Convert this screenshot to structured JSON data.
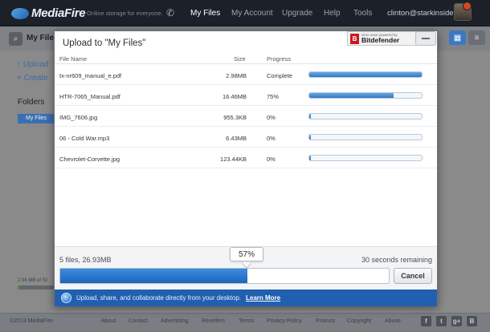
{
  "topbar": {
    "logo": "MediaFire",
    "tagline": "Online storage for everyone.",
    "nav": [
      "My Files",
      "My Account",
      "Upgrade",
      "Help",
      "Tools"
    ],
    "user_email": "clinton@starkinsider..."
  },
  "background": {
    "title": "My Files",
    "upload_link": "Upload",
    "create_link": "Create",
    "folders_heading": "Folders",
    "folder_item": "My Files",
    "storage_text": "2.98 MB of 50",
    "storage_fraction": 0.06,
    "copyright": "©2013 MediaFire",
    "footer_links": [
      "About",
      "Contact",
      "Advertising",
      "Resellers",
      "Terms",
      "Privacy Policy",
      "Promos",
      "Copyright",
      "Abuse"
    ],
    "social": [
      "f",
      "t",
      "g+",
      "B"
    ]
  },
  "modal": {
    "title": "Upload to \"My Files\"",
    "badge_small": "virus scan powered by",
    "badge_name": "Bitdefender",
    "columns": {
      "name": "File Name",
      "size": "Size",
      "progress": "Progress"
    },
    "files": [
      {
        "name": "tx-nr609_manual_e.pdf",
        "size": "2.98MB",
        "status": "Complete",
        "progress": 1.0
      },
      {
        "name": "HTR-7065_Manual.pdf",
        "size": "16.46MB",
        "status": "75%",
        "progress": 0.75
      },
      {
        "name": "IMG_7606.jpg",
        "size": "955.3KB",
        "status": "0%",
        "progress": 0.0
      },
      {
        "name": "06 - Cold War.mp3",
        "size": "6.43MB",
        "status": "0%",
        "progress": 0.0
      },
      {
        "name": "Chevrolet-Corvette.jpg",
        "size": "123.44KB",
        "status": "0%",
        "progress": 0.0
      }
    ],
    "summary": "5 files, 26.93MB",
    "remaining": "30 seconds remaining",
    "overall_percent": "57%",
    "overall_progress": 0.57,
    "cancel_label": "Cancel",
    "promo_text": "Upload, share, and collaborate directly from your desktop.",
    "promo_link": "Learn More"
  }
}
